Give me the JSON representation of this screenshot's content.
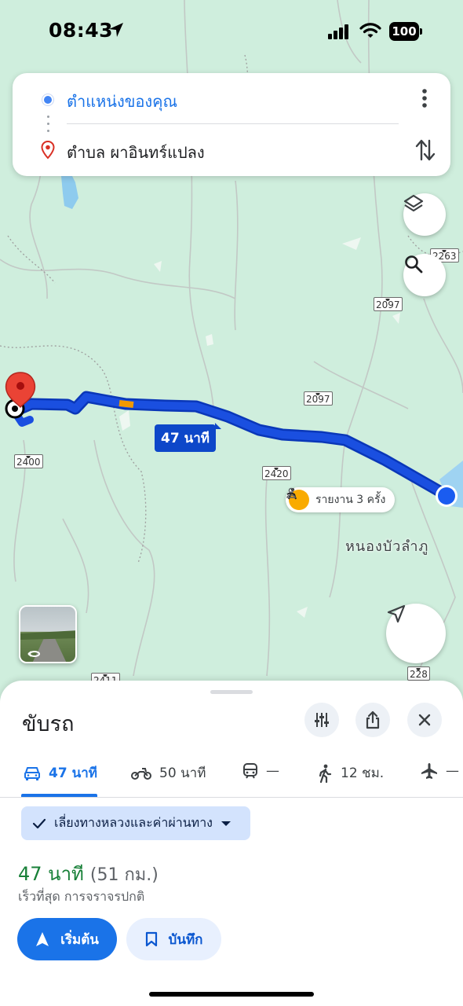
{
  "status_bar": {
    "time": "08:43",
    "battery": "100"
  },
  "route": {
    "origin": "ตำแหน่งของคุณ",
    "destination": "ตำบล ผาอินทร์แปลง"
  },
  "map": {
    "shields": [
      "2263",
      "2097",
      "2097",
      "2400",
      "2420",
      "228",
      "2411"
    ],
    "duration_label": "47 นาที",
    "report_label": "รายงาน 3 ครั้ง",
    "place_label": "หนองบัวลำภู"
  },
  "sheet": {
    "title": "ขับรถ",
    "modes": {
      "drive": "47 นาที",
      "motorbike": "50 นาที",
      "transit": "—",
      "walk": "12 ชม.",
      "flight": "—"
    },
    "avoid_chip": "เลี่ยงทางหลวงและค่าผ่านทาง",
    "summary_time": "47 นาที",
    "summary_distance": "(51 กม.)",
    "summary_sub": "เร็วที่สุด การจราจรปกติ",
    "start_label": "เริ่มต้น",
    "save_label": "บันทึก"
  },
  "colors": {
    "route": "#1a4fe0",
    "accent": "#1a73e8",
    "time_green": "#188038",
    "map_bg": "#cfeedd"
  },
  "icons": [
    "location-arrow-icon",
    "signal-icon",
    "wifi-icon",
    "battery-icon",
    "more-vert-icon",
    "swap-icon",
    "layers-icon",
    "search-icon",
    "navigate-icon",
    "car-icon",
    "motorbike-icon",
    "train-icon",
    "walk-icon",
    "flight-icon",
    "tune-icon",
    "share-icon",
    "close-icon",
    "check-icon",
    "caret-down-icon",
    "bookmark-icon",
    "report-worker-icon",
    "person-icon"
  ]
}
